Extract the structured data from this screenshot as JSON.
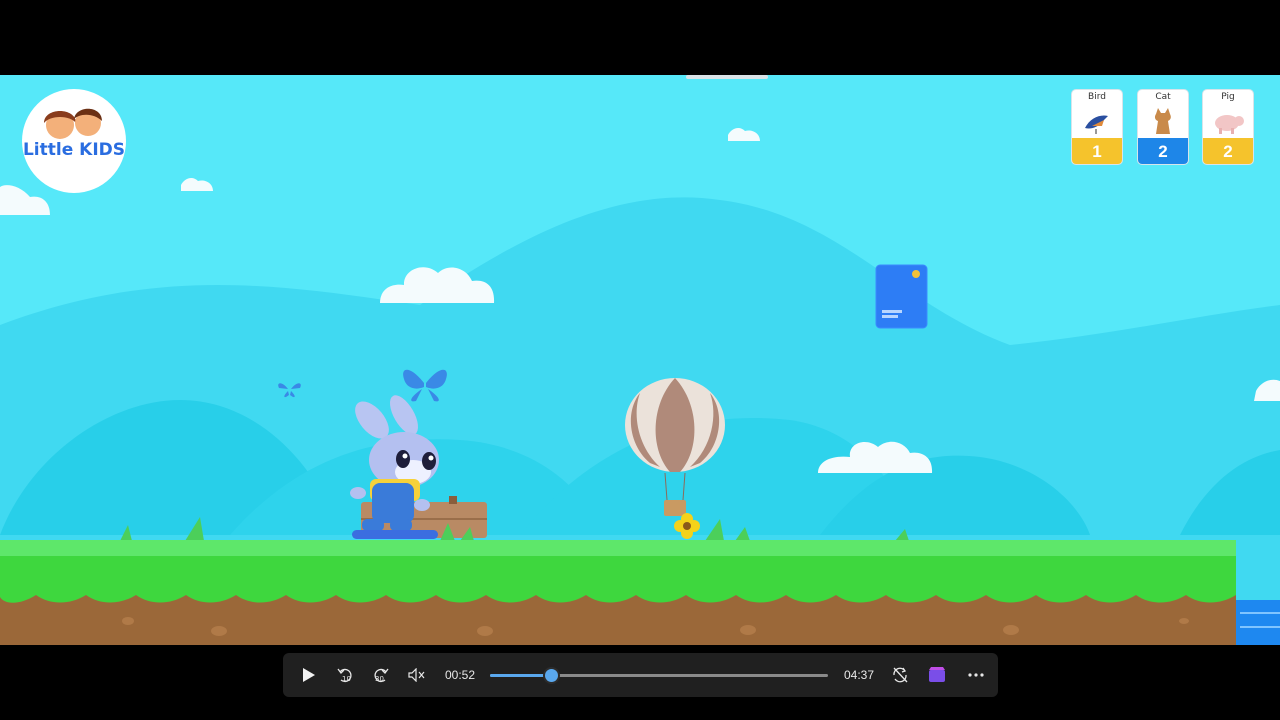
{
  "game": {
    "logo_text": "Little KIDS",
    "cards": [
      {
        "name": "Bird",
        "count": "1",
        "color": "#f5c32c"
      },
      {
        "name": "Cat",
        "count": "2",
        "color": "#1e86e8"
      },
      {
        "name": "Pig",
        "count": "2",
        "color": "#f5c32c"
      }
    ]
  },
  "player": {
    "current_time": "00:52",
    "duration": "04:37",
    "progress_fraction": 0.18,
    "icons": {
      "play": "play-icon",
      "rewind": "rewind-10-icon",
      "forward": "forward-30-icon",
      "mute": "mute-icon",
      "loop": "loop-off-icon",
      "clipchamp": "clipchamp-icon",
      "more": "more-options-icon"
    }
  }
}
